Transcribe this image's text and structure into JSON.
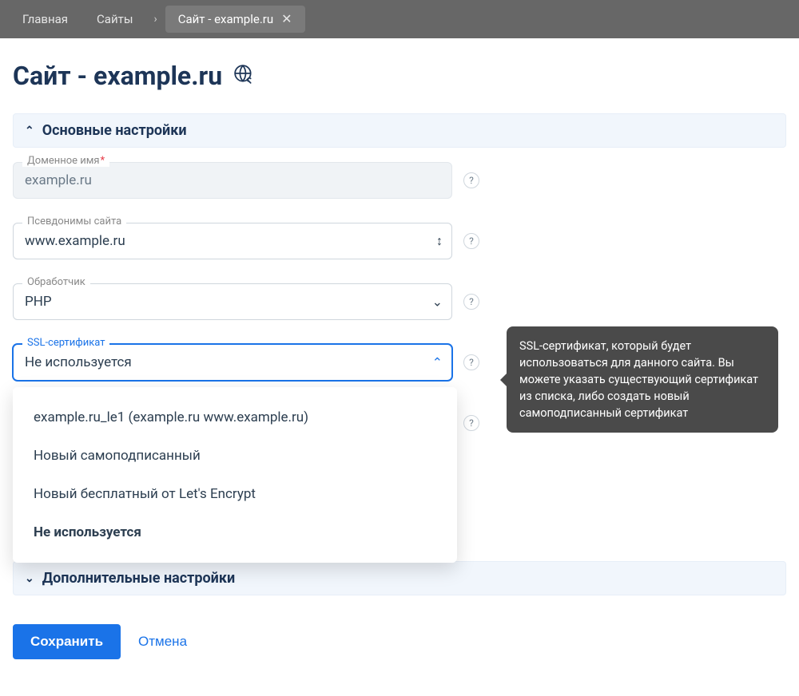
{
  "breadcrumb": {
    "home": "Главная",
    "sites": "Сайты",
    "current": "Сайт - example.ru"
  },
  "page": {
    "title": "Сайт - example.ru"
  },
  "sections": {
    "main": "Основные настройки",
    "additional": "Дополнительные настройки"
  },
  "fields": {
    "domain": {
      "label": "Доменное имя",
      "value": "example.ru"
    },
    "aliases": {
      "label": "Псевдонимы сайта",
      "value": "www.example.ru"
    },
    "handler": {
      "label": "Обработчик",
      "value": "PHP"
    },
    "ssl": {
      "label": "SSL-сертификат",
      "value": "Не используется"
    }
  },
  "ssl_options": [
    "example.ru_le1 (example.ru www.example.ru)",
    "Новый самоподписанный",
    "Новый бесплатный от Let's Encrypt",
    "Не используется"
  ],
  "ssl_selected_index": 3,
  "tooltip": {
    "ssl": "SSL-сертификат, который будет использоваться для данного сайта. Вы можете указать существующий сертификат из списка, либо создать новый самоподписанный сертификат"
  },
  "actions": {
    "save": "Сохранить",
    "cancel": "Отмена"
  }
}
